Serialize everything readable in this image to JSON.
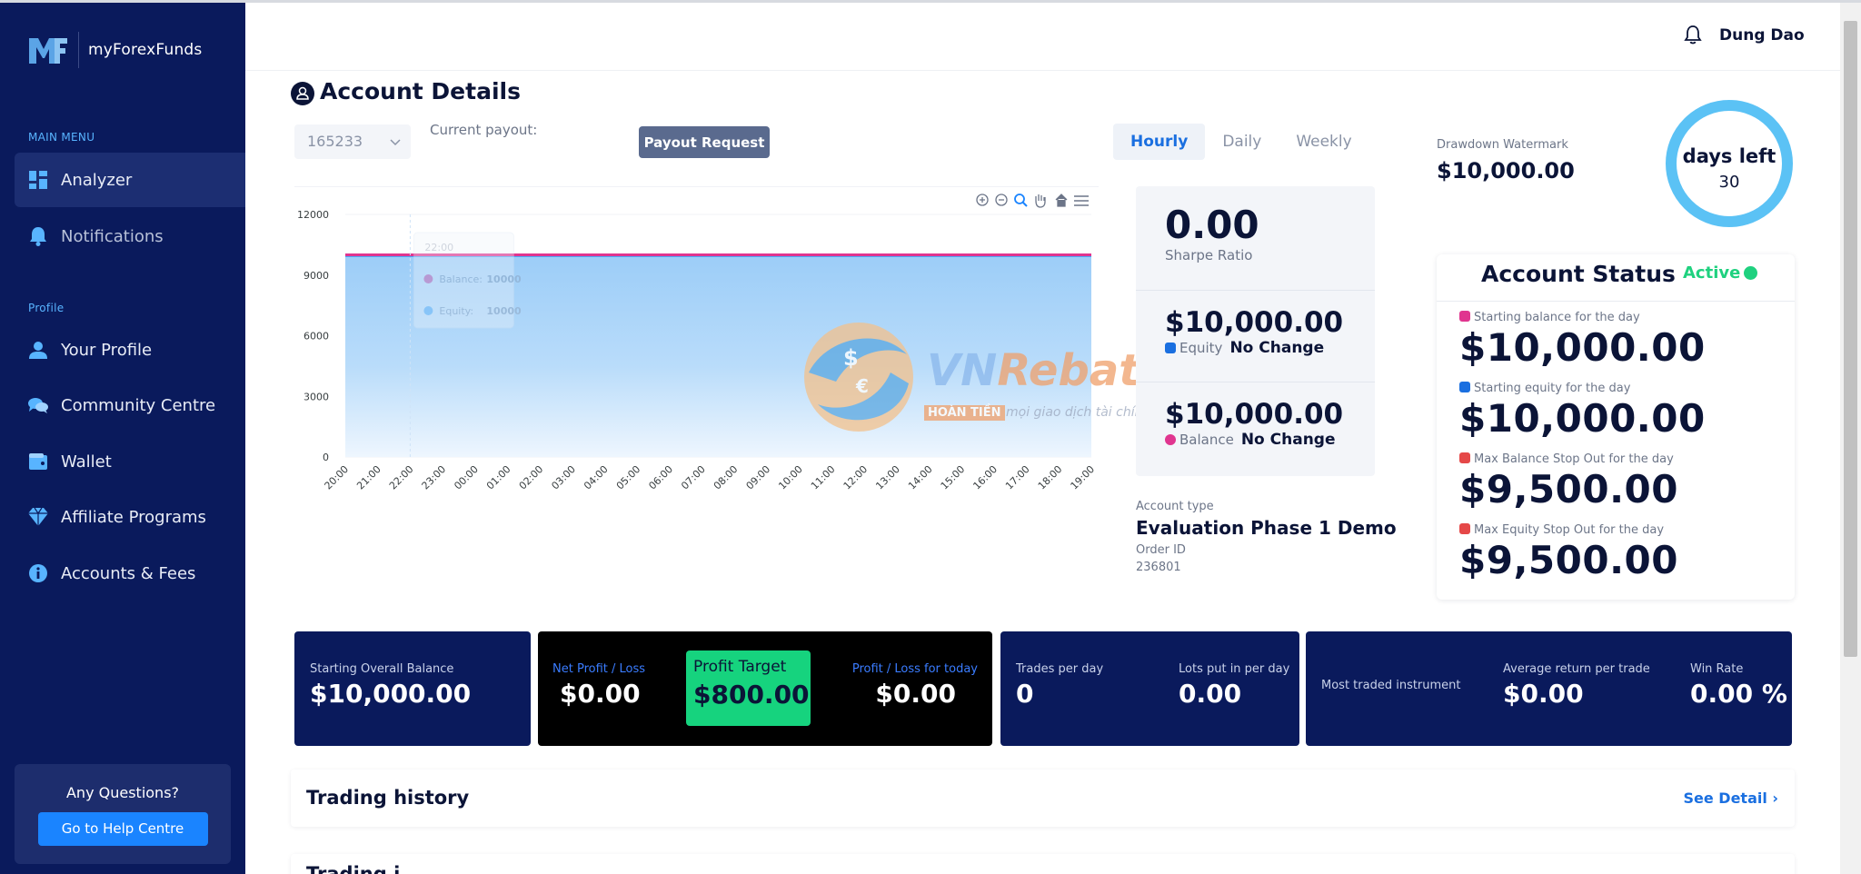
{
  "brand": {
    "name": "myForexFunds"
  },
  "sidebar": {
    "main_menu_label": "MAIN MENU",
    "profile_label": "Profile",
    "items": [
      {
        "label": "Analyzer",
        "icon": "dashboard-icon"
      },
      {
        "label": "Notifications",
        "icon": "bell-icon"
      },
      {
        "label": "Your Profile",
        "icon": "user-icon"
      },
      {
        "label": "Community Centre",
        "icon": "chat-icon"
      },
      {
        "label": "Wallet",
        "icon": "wallet-icon"
      },
      {
        "label": "Affiliate Programs",
        "icon": "diamond-icon"
      },
      {
        "label": "Accounts & Fees",
        "icon": "info-icon"
      }
    ],
    "help": {
      "title": "Any Questions?",
      "button": "Go to Help Centre"
    }
  },
  "header": {
    "user_name": "Dung Dao"
  },
  "page": {
    "title": "Account Details"
  },
  "controls": {
    "account_number": "165233",
    "payout_label": "Current payout:",
    "payout_button": "Payout Request",
    "periods": [
      "Hourly",
      "Daily",
      "Weekly"
    ],
    "active_period": "Hourly"
  },
  "chart_data": {
    "type": "area",
    "x": [
      "20:00",
      "21:00",
      "22:00",
      "23:00",
      "00:00",
      "01:00",
      "02:00",
      "03:00",
      "04:00",
      "05:00",
      "06:00",
      "07:00",
      "08:00",
      "09:00",
      "10:00",
      "11:00",
      "12:00",
      "13:00",
      "14:00",
      "15:00",
      "16:00",
      "17:00",
      "18:00",
      "19:00"
    ],
    "series": [
      {
        "name": "Balance",
        "values": [
          10000,
          10000,
          10000,
          10000,
          10000,
          10000,
          10000,
          10000,
          10000,
          10000,
          10000,
          10000,
          10000,
          10000,
          10000,
          10000,
          10000,
          10000,
          10000,
          10000,
          10000,
          10000,
          10000,
          10000
        ],
        "color": "#e0358f"
      },
      {
        "name": "Equity",
        "values": [
          10000,
          10000,
          10000,
          10000,
          10000,
          10000,
          10000,
          10000,
          10000,
          10000,
          10000,
          10000,
          10000,
          10000,
          10000,
          10000,
          10000,
          10000,
          10000,
          10000,
          10000,
          10000,
          10000,
          10000
        ],
        "color": "#4aa8f7"
      }
    ],
    "yticks": [
      0,
      3000,
      6000,
      9000,
      12000
    ],
    "ylim": [
      0,
      12000
    ],
    "tooltip": {
      "x": "22:00",
      "balance_label": "Balance:",
      "balance_value": "10000",
      "equity_label": "Equity:",
      "equity_value": "10000"
    }
  },
  "stats": {
    "sharpe_value": "0.00",
    "sharpe_label": "Sharpe Ratio",
    "equity_value": "$10,000.00",
    "equity_label": "Equity",
    "equity_change": "No Change",
    "balance_value": "$10,000.00",
    "balance_label": "Balance",
    "balance_change": "No Change"
  },
  "account": {
    "type_label": "Account type",
    "type_value": "Evaluation Phase 1 Demo",
    "order_label": "Order ID",
    "order_value": "236801"
  },
  "drawdown": {
    "label": "Drawdown Watermark",
    "value": "$10,000.00"
  },
  "days_left": {
    "label": "days left",
    "value": "30"
  },
  "status": {
    "title": "Account Status",
    "state": "Active",
    "rows": [
      {
        "label": "Starting balance for the day",
        "value": "$10,000.00",
        "color": "#e0358f"
      },
      {
        "label": "Starting equity for the day",
        "value": "$10,000.00",
        "color": "#1a6fe0"
      },
      {
        "label": "Max Balance Stop Out for the day",
        "value": "$9,500.00",
        "color": "#e54848"
      },
      {
        "label": "Max Equity Stop Out for the day",
        "value": "$9,500.00",
        "color": "#e54848"
      }
    ]
  },
  "metrics": {
    "starting_balance_label": "Starting Overall Balance",
    "starting_balance_value": "$10,000.00",
    "net_pl_label": "Net Profit / Loss",
    "net_pl_value": "$0.00",
    "profit_target_label": "Profit Target",
    "profit_target_value": "$800.00",
    "pl_today_label": "Profit / Loss for today",
    "pl_today_value": "$0.00",
    "trades_label": "Trades per day",
    "trades_value": "0",
    "lots_label": "Lots put in per day",
    "lots_value": "0.00",
    "instrument_label": "Most traded instrument",
    "avg_return_label": "Average return per trade",
    "avg_return_value": "$0.00",
    "win_rate_label": "Win Rate",
    "win_rate_value": "0.00 %"
  },
  "history": {
    "title": "Trading history",
    "link": "See Detail",
    "next_title": "Trading j"
  },
  "watermark": {
    "brand": "VN",
    "brand2": "Rebates",
    "tag": "HOÀN TIỀN",
    "sub": "mọi giao dịch tài chính c"
  },
  "colors": {
    "navy": "#0a1a5c",
    "accent": "#1a84ff",
    "active": "#1fd17f",
    "target": "#16d37e"
  }
}
